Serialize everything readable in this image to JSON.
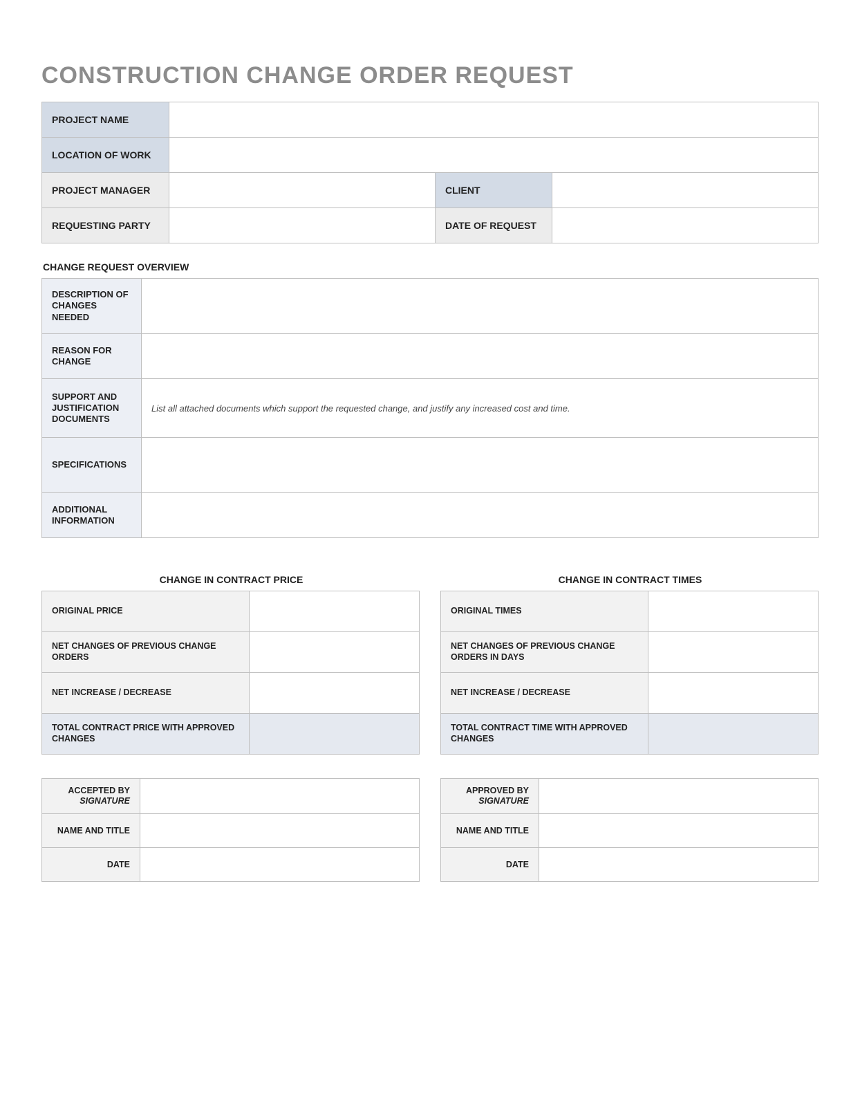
{
  "title": "CONSTRUCTION CHANGE ORDER REQUEST",
  "top": {
    "project_name_label": "PROJECT NAME",
    "project_name_value": "",
    "location_label": "LOCATION OF WORK",
    "location_value": "",
    "pm_label": "PROJECT MANAGER",
    "pm_value": "",
    "client_label": "CLIENT",
    "client_value": "",
    "req_party_label": "REQUESTING PARTY",
    "req_party_value": "",
    "date_label": "DATE OF REQUEST",
    "date_value": ""
  },
  "overview_heading": "CHANGE REQUEST OVERVIEW",
  "overview": {
    "desc_label": "DESCRIPTION OF CHANGES NEEDED",
    "desc_value": "",
    "reason_label": "REASON FOR CHANGE",
    "reason_value": "",
    "support_label": "SUPPORT AND JUSTIFICATION DOCUMENTS",
    "support_value": "List all attached documents which support the requested change, and justify any increased cost and time.",
    "spec_label": "SPECIFICATIONS",
    "spec_value": "",
    "add_label": "ADDITIONAL INFORMATION",
    "add_value": ""
  },
  "price_heading": "CHANGE IN CONTRACT PRICE",
  "price": {
    "orig_label": "ORIGINAL PRICE",
    "orig_value": "",
    "net_prev_label": "NET CHANGES OF PREVIOUS CHANGE ORDERS",
    "net_prev_value": "",
    "net_inc_label": "NET INCREASE / DECREASE",
    "net_inc_value": "",
    "total_label": "TOTAL CONTRACT PRICE WITH APPROVED CHANGES",
    "total_value": ""
  },
  "times_heading": "CHANGE IN CONTRACT TIMES",
  "times": {
    "orig_label": "ORIGINAL TIMES",
    "orig_value": "",
    "net_prev_label": "NET CHANGES OF PREVIOUS CHANGE ORDERS IN DAYS",
    "net_prev_value": "",
    "net_inc_label": "NET INCREASE / DECREASE",
    "net_inc_value": "",
    "total_label": "TOTAL CONTRACT TIME WITH APPROVED CHANGES",
    "total_value": ""
  },
  "accepted": {
    "by_label": "ACCEPTED BY",
    "sig_sub": "SIGNATURE",
    "by_value": "",
    "name_label": "NAME AND TITLE",
    "name_value": "",
    "date_label": "DATE",
    "date_value": ""
  },
  "approved": {
    "by_label": "APPROVED BY",
    "sig_sub": "SIGNATURE",
    "by_value": "",
    "name_label": "NAME AND TITLE",
    "name_value": "",
    "date_label": "DATE",
    "date_value": ""
  }
}
